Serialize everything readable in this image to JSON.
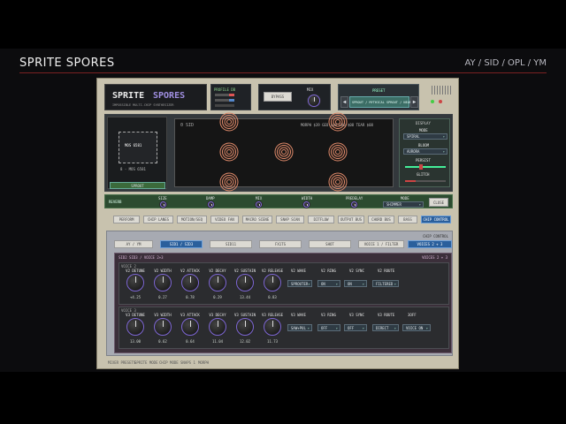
{
  "header": {
    "title": "SPRITE SPORES",
    "chips": "AY / SID / OPL / YM"
  },
  "logo": {
    "word1": "SPRITE",
    "word2": "SPORES",
    "tagline": "IMPOSSIBLE MULTI-CHIP SYNTHESIZER"
  },
  "meter": {
    "label": "PROFILE DB"
  },
  "bypass": {
    "label": "BYPASS"
  },
  "mix": {
    "label": "MIX"
  },
  "preset": {
    "label": "PRESET",
    "value": "SPROUT / MYTHICAL SPROUT / NEARBY"
  },
  "chip": {
    "name": "MOS 6581",
    "sub": "8 - MOS 6581",
    "button": "SPROUT"
  },
  "display": {
    "left": "0 SID",
    "right": "MORPH $39   GEO $40   GHO $08   TEAR $08"
  },
  "display_side": {
    "title": "DISPLAY",
    "mode_label": "MODE",
    "mode": "SPIRAL",
    "bloom_label": "BLOOM",
    "bloom": "AURORA",
    "persist_label": "PERSIST",
    "glitch_label": "GLITCH"
  },
  "reverb": {
    "label": "REVERB",
    "knobs": [
      "SIZE",
      "DAMP",
      "MIX",
      "WIDTH",
      "PREDELAY"
    ],
    "mode_label": "MODE",
    "mode": "SHIMMER",
    "close": "CLOSE"
  },
  "nav_tabs": [
    "PERFORM",
    "CHIP LANES",
    "MOTION/SEQ",
    "VIDEO FAN",
    "MACRO SCENE",
    "SNAP SCAN",
    "DITFLOW",
    "OUTPUT BUS",
    "CHORD BUS",
    "BASS",
    "CHIP CONTROL"
  ],
  "chip_section_label": "CHIP CONTROL",
  "chip_tabs": [
    "AY / YM",
    "SID1 / SID3",
    "SID11",
    "FX1TS",
    "SHOT",
    "VOICE 1 / FILTER",
    "VOICES 2 + 3"
  ],
  "voices_panel": {
    "title": "SID2 SID3 / VOICE 2+3",
    "right": "VOICES 2 + 3"
  },
  "voice2": {
    "label": "VOICE 2",
    "knobs": [
      {
        "label": "V2 DETUNE",
        "value": "+4.25"
      },
      {
        "label": "V2 WIDTH",
        "value": "0.27"
      },
      {
        "label": "V2 ATTACK",
        "value": "0.78"
      },
      {
        "label": "V2 DECAY",
        "value": "0.29"
      },
      {
        "label": "V2 SUSTAIN",
        "value": "13.44"
      },
      {
        "label": "V2 RELEASE",
        "value": "0.83"
      }
    ],
    "selects": [
      {
        "label": "V2 WAVE",
        "value": "SPROUTER"
      },
      {
        "label": "V2 RING",
        "value": "ON"
      },
      {
        "label": "V2 SYNC",
        "value": "ON"
      },
      {
        "label": "V2 ROUTE",
        "value": "FILTERED"
      }
    ]
  },
  "voice3": {
    "label": "VOICE 3",
    "knobs": [
      {
        "label": "V3 DETUNE",
        "value": "13.00"
      },
      {
        "label": "V3 WIDTH",
        "value": "0.62"
      },
      {
        "label": "V3 ATTACK",
        "value": "0.64"
      },
      {
        "label": "V3 DECAY",
        "value": "11.04"
      },
      {
        "label": "V3 SUSTAIN",
        "value": "12.02"
      },
      {
        "label": "V3 RELEASE",
        "value": "11.73"
      }
    ],
    "selects": [
      {
        "label": "V3 WAVE",
        "value": "SAW+PUL"
      },
      {
        "label": "V3 RING",
        "value": "OFF"
      },
      {
        "label": "V3 SYNC",
        "value": "OFF"
      },
      {
        "label": "V3 ROUTE",
        "value": "DIRECT"
      },
      {
        "label": "3OFF",
        "value": "VOICE ON"
      }
    ]
  },
  "footer": [
    "MIXER PRESETS",
    "SPRITE MODE",
    "CHIP MODE",
    "SNAPS 1",
    "MORPH"
  ],
  "colors": {
    "accent": "#7d67d6",
    "panel": "#c8c2ae",
    "green": "#2c4b30",
    "rule": "#7b2222"
  }
}
